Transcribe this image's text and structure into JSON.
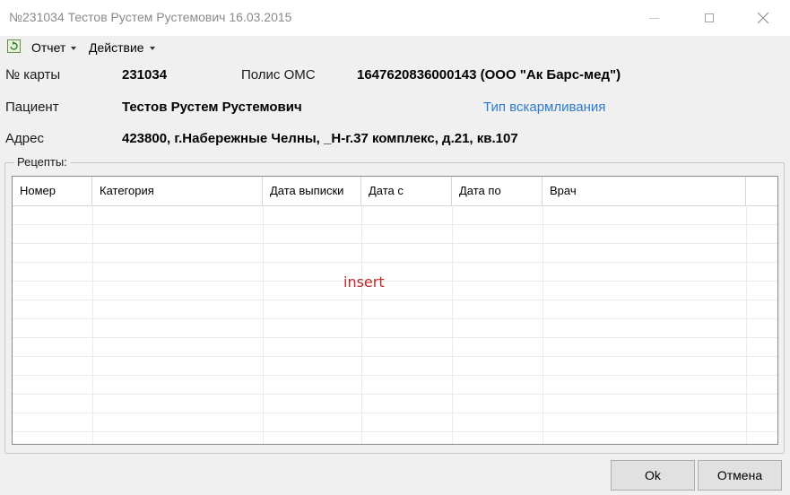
{
  "window": {
    "title": "№231034 Тестов Рустем Рустемович 16.03.2015",
    "minimize_glyph": "—",
    "close_glyph": "✕"
  },
  "menu": {
    "icon": "refresh-icon",
    "items": [
      {
        "label": "Отчет"
      },
      {
        "label": "Действие"
      }
    ]
  },
  "info": {
    "card_label": "№ карты",
    "card_value": "231034",
    "policy_label": "Полис ОМС",
    "policy_value": "1647620836000143 (ООО \"Ак Барс-мед\")",
    "patient_label": "Пациент",
    "patient_value": "Тестов Рустем Рустемович",
    "feeding_link": "Тип вскармливания",
    "address_label": "Адрес",
    "address_value": "423800, г.Набережные Челны, _Н-г.37 комплекс, д.21, кв.107"
  },
  "prescriptions": {
    "group_label": "Рецепты:",
    "columns": [
      "Номер",
      "Категория",
      "Дата выписки",
      "Дата с",
      "Дата по",
      "Врач"
    ],
    "rows": [],
    "overlay_text": "insert"
  },
  "buttons": {
    "ok": "Ok",
    "cancel": "Отмена"
  }
}
